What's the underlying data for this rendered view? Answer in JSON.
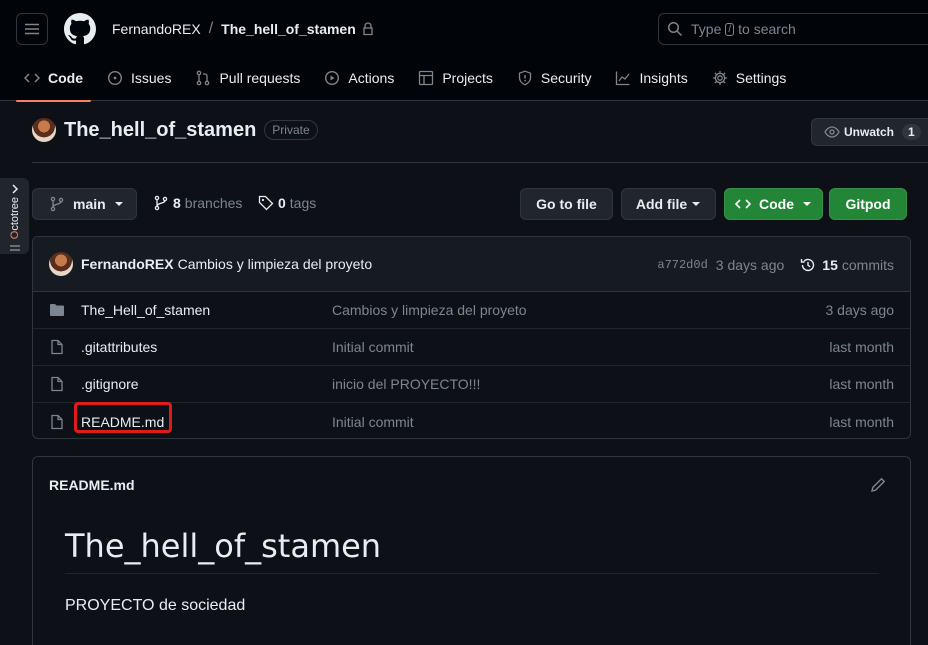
{
  "header": {
    "owner": "FernandoREX",
    "separator": "/",
    "repo": "The_hell_of_stamen",
    "search_prefix": "Type",
    "search_key": "/",
    "search_suffix": "to search"
  },
  "tabs": [
    {
      "label": "Code",
      "icon": "code-icon"
    },
    {
      "label": "Issues",
      "icon": "issue-icon"
    },
    {
      "label": "Pull requests",
      "icon": "pull-request-icon"
    },
    {
      "label": "Actions",
      "icon": "play-icon"
    },
    {
      "label": "Projects",
      "icon": "table-icon"
    },
    {
      "label": "Security",
      "icon": "shield-icon"
    },
    {
      "label": "Insights",
      "icon": "graph-icon"
    },
    {
      "label": "Settings",
      "icon": "gear-icon"
    }
  ],
  "repo": {
    "name": "The_hell_of_stamen",
    "visibility": "Private",
    "unwatch_label": "Unwatch",
    "watch_count": "1"
  },
  "octotree": {
    "prefix": "O",
    "label": "ctotree"
  },
  "toolbar": {
    "branch": "main",
    "branches_count": "8",
    "branches_label": "branches",
    "tags_count": "0",
    "tags_label": "tags",
    "go_to_file": "Go to file",
    "add_file": "Add file",
    "code": "Code",
    "gitpod": "Gitpod"
  },
  "latest_commit": {
    "author": "FernandoREX",
    "message": "Cambios y limpieza del proyeto",
    "sha": "a772d0d",
    "time": "3 days ago",
    "commits_count": "15",
    "commits_label": "commits"
  },
  "files": [
    {
      "type": "folder",
      "name": "The_Hell_of_stamen",
      "message": "Cambios y limpieza del proyeto",
      "date": "3 days ago"
    },
    {
      "type": "file",
      "name": ".gitattributes",
      "message": "Initial commit",
      "date": "last month"
    },
    {
      "type": "file",
      "name": ".gitignore",
      "message": "inicio del PROYECTO!!!",
      "date": "last month"
    },
    {
      "type": "file",
      "name": "README.md",
      "message": "Initial commit",
      "date": "last month"
    }
  ],
  "readme": {
    "filename": "README.md",
    "heading": "The_hell_of_stamen",
    "body": "PROYECTO de sociedad"
  },
  "colors": {
    "background": "#0d1117",
    "header_bg": "#010409",
    "accent_tab": "#f78166",
    "green": "#238636",
    "highlight": "#e01b1b"
  }
}
